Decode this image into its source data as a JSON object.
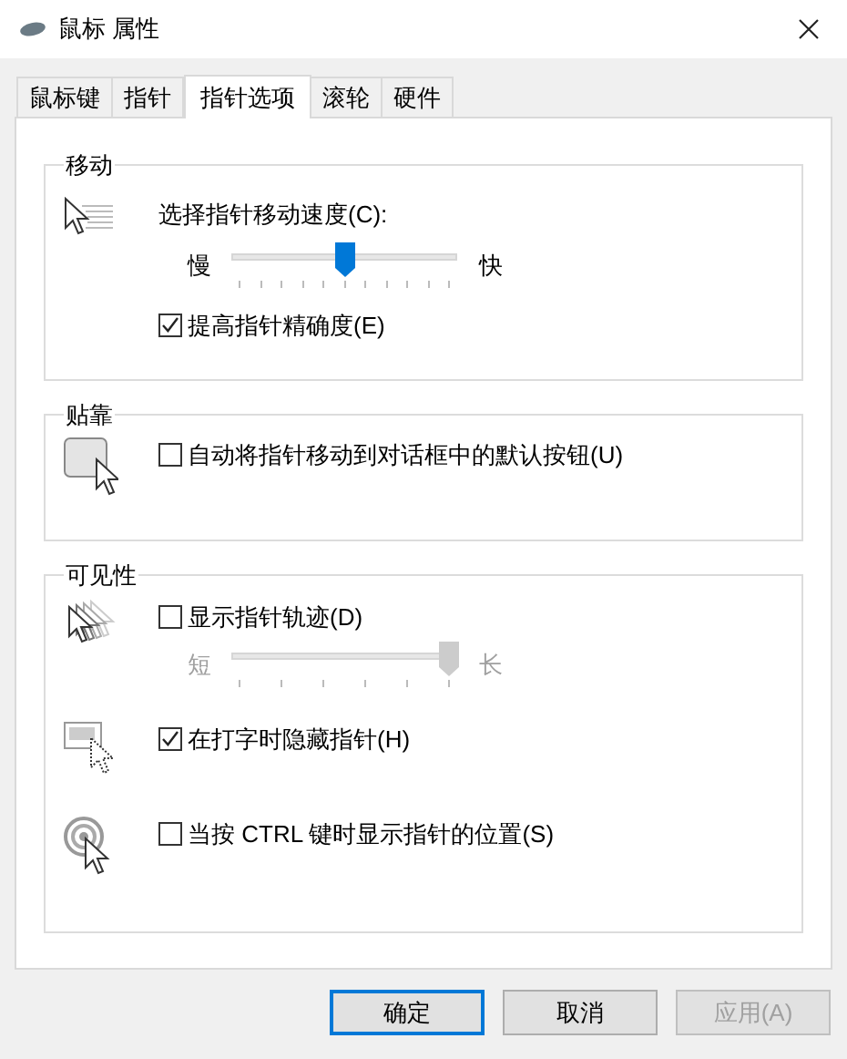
{
  "window": {
    "title": "鼠标 属性"
  },
  "tabs": [
    {
      "label": "鼠标键",
      "selected": false
    },
    {
      "label": "指针",
      "selected": false
    },
    {
      "label": "指针选项",
      "selected": true
    },
    {
      "label": "滚轮",
      "selected": false
    },
    {
      "label": "硬件",
      "selected": false
    }
  ],
  "groups": [
    {
      "title": "移动",
      "rows": [
        {
          "kind": "label",
          "label": "选择指针移动速度(C):"
        },
        {
          "kind": "slider",
          "min_label": "慢",
          "max_label": "快",
          "level": 0.5,
          "disabled": false
        },
        {
          "kind": "checkbox",
          "label": "提高指针精确度(E)",
          "checked": true
        }
      ]
    },
    {
      "title": "贴靠",
      "rows": [
        {
          "kind": "checkbox",
          "label": "自动将指针移动到对话框中的默认按钮(U)",
          "checked": false
        }
      ]
    },
    {
      "title": "可见性",
      "rows": [
        {
          "kind": "checkbox",
          "label": "显示指针轨迹(D)",
          "checked": false
        },
        {
          "kind": "slider",
          "min_label": "短",
          "max_label": "长",
          "level": 1,
          "disabled": true
        },
        {
          "kind": "checkbox",
          "label": "在打字时隐藏指针(H)",
          "checked": true
        },
        {
          "kind": "checkbox",
          "label": "当按 CTRL 键时显示指针的位置(S)",
          "checked": false
        }
      ]
    }
  ],
  "buttons": [
    {
      "label": "确定",
      "default": true,
      "disabled": false
    },
    {
      "label": "取消",
      "default": false,
      "disabled": false
    },
    {
      "label": "应用(A)",
      "default": false,
      "disabled": true
    }
  ]
}
